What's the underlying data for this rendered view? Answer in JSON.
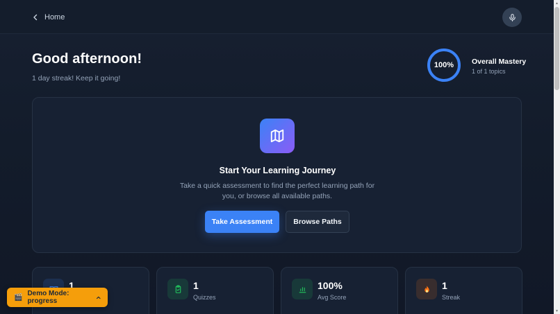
{
  "header": {
    "back_label": "Home",
    "icons": {
      "back": "chevron-left-icon",
      "mic": "microphone-icon"
    }
  },
  "greeting": {
    "title": "Good afternoon!",
    "subtitle": "1 day streak! Keep it going!"
  },
  "mastery": {
    "percent_label": "100%",
    "percent_value": 100,
    "title": "Overall Mastery",
    "subtitle": "1 of 1 topics",
    "ring_color": "#3b82f6"
  },
  "journey": {
    "icon": "map-icon",
    "title": "Start Your Learning Journey",
    "description": "Take a quick assessment to find the perfect learning path for you, or browse all available paths.",
    "primary_button": "Take Assessment",
    "secondary_button": "Browse Paths"
  },
  "stats": [
    {
      "value": "1",
      "label": "",
      "icon": "book-icon",
      "color": "#3b82f6"
    },
    {
      "value": "1",
      "label": "Quizzes",
      "icon": "clipboard-check-icon",
      "color": "#22c55e"
    },
    {
      "value": "100%",
      "label": "Avg Score",
      "icon": "bar-chart-icon",
      "color": "#22c55e"
    },
    {
      "value": "1",
      "label": "Streak",
      "icon": "flame-icon",
      "color": "#f97316"
    }
  ],
  "demo": {
    "label": "Demo Mode: progress",
    "icon": "clapperboard-icon",
    "chevron": "chevron-up-icon",
    "color": "#f59e0b"
  },
  "colors": {
    "accent": "#3b82f6",
    "background": "#111827",
    "card": "#172133"
  }
}
